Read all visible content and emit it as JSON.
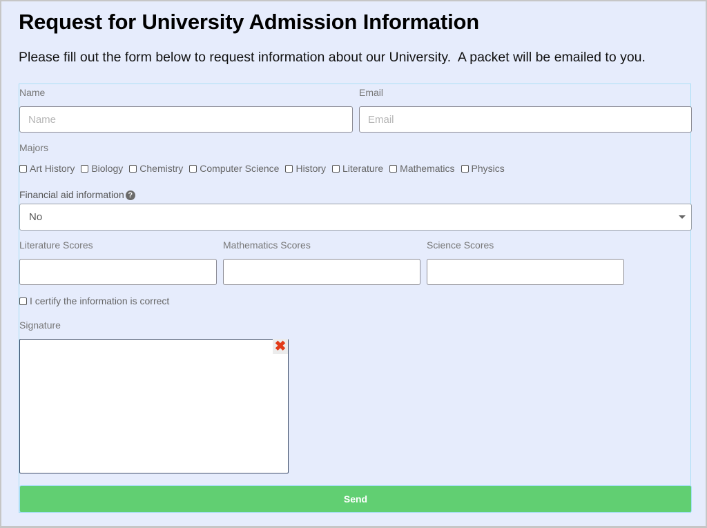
{
  "header": {
    "title": "Request for University Admission Information",
    "intro": "Please fill out the form below to request information about our University.  A packet will be emailed to you."
  },
  "form": {
    "name": {
      "label": "Name",
      "placeholder": "Name",
      "value": ""
    },
    "email": {
      "label": "Email",
      "placeholder": "Email",
      "value": ""
    },
    "majors": {
      "label": "Majors",
      "options": [
        {
          "label": "Art History",
          "checked": false
        },
        {
          "label": "Biology",
          "checked": false
        },
        {
          "label": "Chemistry",
          "checked": false
        },
        {
          "label": "Computer Science",
          "checked": false
        },
        {
          "label": "History",
          "checked": false
        },
        {
          "label": "Literature",
          "checked": false
        },
        {
          "label": "Mathematics",
          "checked": false
        },
        {
          "label": "Physics",
          "checked": false
        }
      ]
    },
    "financial_aid": {
      "label": "Financial aid information",
      "help_icon": "question-circle-icon",
      "selected": "No"
    },
    "scores": {
      "literature": {
        "label": "Literature Scores",
        "value": ""
      },
      "mathematics": {
        "label": "Mathematics Scores",
        "value": ""
      },
      "science": {
        "label": "Science Scores",
        "value": ""
      }
    },
    "certify": {
      "label": "I certify the information is correct",
      "checked": false
    },
    "signature": {
      "label": "Signature",
      "clear_icon": "close-icon",
      "clear_glyph": "✖"
    },
    "send_label": "Send"
  },
  "colors": {
    "background": "#e6ecfc",
    "send_button": "#61cf72",
    "form_border": "#a9dff5",
    "clear_icon": "#e23a18"
  }
}
